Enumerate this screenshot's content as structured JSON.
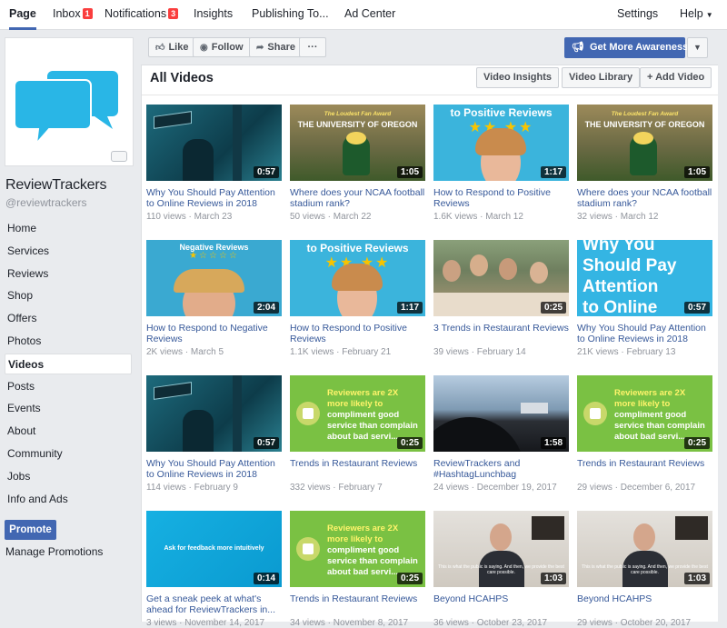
{
  "topnav": [
    {
      "label": "Page"
    },
    {
      "label": "Inbox",
      "badge": "1"
    },
    {
      "label": "Notifications",
      "badge": "3"
    },
    {
      "label": "Insights"
    },
    {
      "label": "Publishing To..."
    },
    {
      "label": "Ad Center"
    },
    {
      "label": "Settings"
    },
    {
      "label": "Help"
    }
  ],
  "page": {
    "name": "ReviewTrackers",
    "handle": "@reviewtrackers",
    "brand_color": "#29b6e6"
  },
  "sidebar": {
    "items": [
      "Home",
      "Services",
      "Reviews",
      "Shop",
      "Offers",
      "Photos",
      "Videos",
      "Posts",
      "Events",
      "About",
      "Community",
      "Jobs",
      "Info and Ads"
    ],
    "active": "Videos",
    "promote_label": "Promote",
    "manage_label": "Manage Promotions"
  },
  "actions": {
    "like": "Like",
    "follow": "Follow",
    "share": "Share",
    "more": "···",
    "awareness": "Get More Awareness"
  },
  "panel": {
    "title": "All Videos",
    "insights": "Video Insights",
    "library": "Video Library",
    "add": "+ Add Video"
  },
  "videos": [
    {
      "title": "Why You Should Pay Attention to Online Reviews in 2018",
      "views": "110 views",
      "date": "March 23",
      "duration": "0:57",
      "icon": "street-sign-thumb"
    },
    {
      "title": "Where does your NCAA football stadium rank?",
      "views": "50 views",
      "date": "March 22",
      "duration": "1:05",
      "icon": "oregon-mascot-thumb",
      "overlay_small": "The Loudest Fan Award",
      "overlay_big": "THE UNIVERSITY OF OREGON"
    },
    {
      "title": "How to Respond to Positive Reviews",
      "views": "1.6K views",
      "date": "March 12",
      "duration": "1:17",
      "icon": "positive-reviews-thumb",
      "overlay_big": "to Positive Reviews"
    },
    {
      "title": "Where does your NCAA football stadium rank?",
      "views": "32 views",
      "date": "March 12",
      "duration": "1:05",
      "icon": "oregon-mascot-thumb",
      "overlay_small": "The Loudest Fan Award",
      "overlay_big": "THE UNIVERSITY OF OREGON"
    },
    {
      "title": "How to Respond to Negative Reviews",
      "views": "2K views",
      "date": "March 5",
      "duration": "2:04",
      "icon": "negative-reviews-thumb",
      "overlay_big": "Negative Reviews"
    },
    {
      "title": "How to Respond to Positive Reviews",
      "views": "1.1K views",
      "date": "February 21",
      "duration": "1:17",
      "icon": "positive-reviews-thumb",
      "overlay_big": "to Positive Reviews"
    },
    {
      "title": "3 Trends in Restaurant Reviews",
      "views": "39 views",
      "date": "February 14",
      "duration": "0:25",
      "icon": "restaurant-diners-thumb"
    },
    {
      "title": "Why You Should Pay Attention to Online Reviews in 2018",
      "views": "21K views",
      "date": "February 13",
      "duration": "0:57",
      "icon": "attention-text-thumb",
      "overlay_lines": [
        "Why You",
        "Should Pay",
        "Attention",
        "to Online"
      ]
    },
    {
      "title": "Why You Should Pay Attention to Online Reviews in 2018",
      "views": "114 views",
      "date": "February 9",
      "duration": "0:57",
      "icon": "street-sign-thumb"
    },
    {
      "title": "Trends in Restaurant Reviews",
      "views": "332 views",
      "date": "February 7",
      "duration": "0:25",
      "icon": "green-compliment-thumb",
      "overlay_lines": [
        "Reviewers are 2X",
        "more likely to",
        "compliment good",
        "service than complain",
        "about bad servi..."
      ]
    },
    {
      "title": "ReviewTrackers and #HashtagLunchbag",
      "views": "24 views",
      "date": "December 19, 2017",
      "duration": "1:58",
      "icon": "car-interior-thumb"
    },
    {
      "title": "Trends in Restaurant Reviews",
      "views": "29 views",
      "date": "December 6, 2017",
      "duration": "0:25",
      "icon": "green-compliment-thumb",
      "overlay_lines": [
        "Reviewers are 2X",
        "more likely to",
        "compliment good",
        "service than complain",
        "about bad servi..."
      ]
    },
    {
      "title": "Get a sneak peek at what's ahead for ReviewTrackers in...",
      "views": "3 views",
      "date": "November 14, 2017",
      "duration": "0:14",
      "icon": "blue-feedback-thumb",
      "overlay_big": "Ask for feedback more intuitively"
    },
    {
      "title": "Trends in Restaurant Reviews",
      "views": "34 views",
      "date": "November 8, 2017",
      "duration": "0:25",
      "icon": "green-compliment-thumb",
      "overlay_lines": [
        "Reviewers are 2X",
        "more likely to",
        "compliment good",
        "service than complain",
        "about bad servi..."
      ]
    },
    {
      "title": "Beyond HCAHPS",
      "views": "36 views",
      "date": "October 23, 2017",
      "duration": "1:03",
      "icon": "interview-man-thumb",
      "overlay_small": "This is what the public is saying. And then, we provide the best care possible."
    },
    {
      "title": "Beyond HCAHPS",
      "views": "29 views",
      "date": "October 20, 2017",
      "duration": "1:03",
      "icon": "interview-man-thumb",
      "overlay_small": "This is what the public is saying. And then, we provide the best care possible."
    }
  ]
}
